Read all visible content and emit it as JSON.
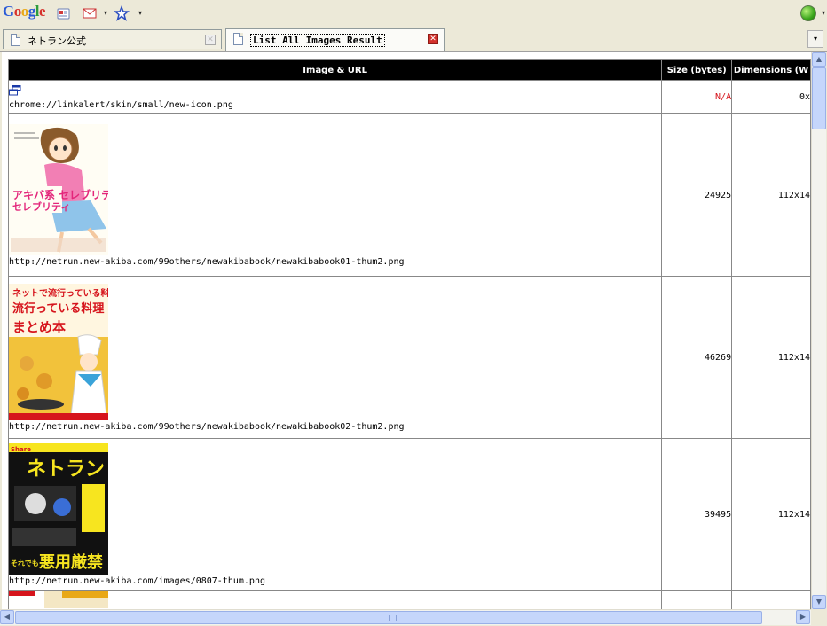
{
  "toolbar": {
    "logo": [
      "G",
      "o",
      "o",
      "g",
      "l",
      "e"
    ],
    "icons": [
      "news-icon",
      "mail-icon",
      "star-icon"
    ]
  },
  "tabs": [
    {
      "label": "ネトラン公式",
      "active": false
    },
    {
      "label": "List All Images Result",
      "active": true
    }
  ],
  "table": {
    "headers": [
      "Image & URL",
      "Size (bytes)",
      "Dimensions (W"
    ],
    "rows": [
      {
        "url": "chrome://linkalert/skin/small/new-icon.png",
        "size": "N/A",
        "dims": "0x"
      },
      {
        "url": "http://netrun.new-akiba.com/99others/newakibabook/newakibabook01-thum2.png",
        "size": "24925",
        "dims": "112x14"
      },
      {
        "url": "http://netrun.new-akiba.com/99others/newakibabook/newakibabook02-thum2.png",
        "size": "46269",
        "dims": "112x14"
      },
      {
        "url": "http://netrun.new-akiba.com/images/0807-thum.png",
        "size": "39495",
        "dims": "112x14"
      }
    ]
  },
  "thumbnails": {
    "book1_title": "アキバ系 セレブリティ",
    "book2_title": "ネットで流行っている料理まとめ本",
    "book3_title": "ネトラン",
    "book3_footer": "悪用厳禁"
  },
  "colors": {
    "header_bg": "#000000",
    "na_text": "#d6141c",
    "active_tab_close": "#d3312b"
  }
}
